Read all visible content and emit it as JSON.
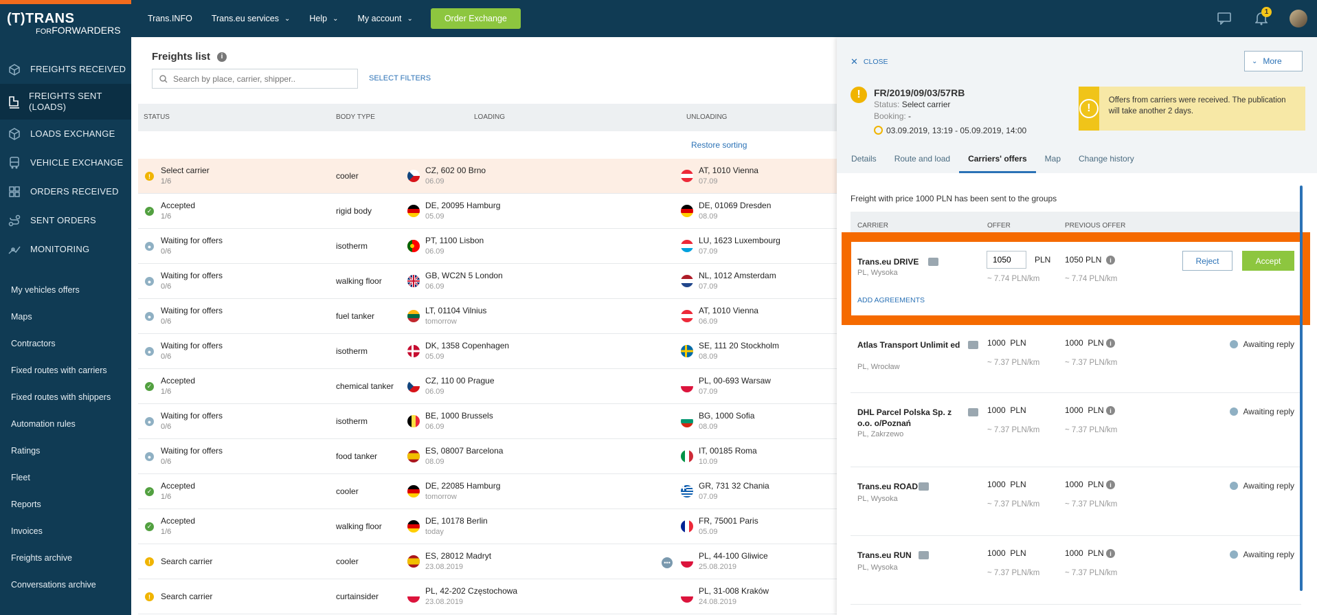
{
  "brand": {
    "line1": "(T)TRANS",
    "line2_prefix": "FOR",
    "line2": "FORWARDERS"
  },
  "sidebar": {
    "main": [
      {
        "label": "FREIGHTS RECEIVED",
        "icon": "freights-received-icon"
      },
      {
        "label": "FREIGHTS SENT (LOADS)",
        "icon": "freights-sent-icon",
        "active": true
      },
      {
        "label": "LOADS EXCHANGE",
        "icon": "box-icon"
      },
      {
        "label": "VEHICLE EXCHANGE",
        "icon": "truck-icon"
      },
      {
        "label": "ORDERS RECEIVED",
        "icon": "grid-icon"
      },
      {
        "label": "SENT ORDERS",
        "icon": "route-icon"
      },
      {
        "label": "MONITORING",
        "icon": "monitoring-icon"
      }
    ],
    "sub": [
      "My vehicles offers",
      "Maps",
      "Contractors",
      "Fixed routes with carriers",
      "Fixed routes with shippers",
      "Automation rules",
      "Ratings",
      "Fleet",
      "Reports",
      "Invoices",
      "Freights archive",
      "Conversations archive"
    ]
  },
  "topbar": {
    "items": [
      "Trans.INFO",
      "Trans.eu services",
      "Help",
      "My account"
    ],
    "order_button": "Order Exchange",
    "notification_count": "1"
  },
  "list": {
    "title": "Freights list",
    "search_placeholder": "Search by place, carrier, shipper..",
    "select_filters": "SELECT FILTERS",
    "headers": {
      "status": "STATUS",
      "body": "BODY TYPE",
      "loading": "LOADING",
      "unloading": "UNLOADING"
    },
    "restore_sorting": "Restore sorting",
    "rows": [
      {
        "status": "Select carrier",
        "sub": "1/6",
        "state": "warn",
        "body": "cooler",
        "load": "CZ, 602 00 Brno",
        "load_date": "06.09",
        "load_flag": "cz",
        "unload": "AT, 1010 Vienna",
        "unload_date": "07.09",
        "unload_flag": "at",
        "highlight": true
      },
      {
        "status": "Accepted",
        "sub": "1/6",
        "state": "ok",
        "body": "rigid body",
        "load": "DE, 20095 Hamburg",
        "load_date": "05.09",
        "load_flag": "de",
        "unload": "DE, 01069 Dresden",
        "unload_date": "08.09",
        "unload_flag": "de"
      },
      {
        "status": "Waiting for offers",
        "sub": "0/6",
        "state": "wait",
        "body": "isotherm",
        "load": "PT, 1100 Lisbon",
        "load_date": "06.09",
        "load_flag": "pt",
        "unload": "LU, 1623 Luxembourg",
        "unload_date": "07.09",
        "unload_flag": "lu"
      },
      {
        "status": "Waiting for offers",
        "sub": "0/6",
        "state": "wait",
        "body": "walking floor",
        "load": "GB, WC2N 5 London",
        "load_date": "06.09",
        "load_flag": "gb",
        "unload": "NL, 1012 Amsterdam",
        "unload_date": "07.09",
        "unload_flag": "nl"
      },
      {
        "status": "Waiting for offers",
        "sub": "0/6",
        "state": "wait",
        "body": "fuel tanker",
        "load": "LT, 01104 Vilnius",
        "load_date": "tomorrow",
        "load_flag": "lt",
        "unload": "AT, 1010 Vienna",
        "unload_date": "06.09",
        "unload_flag": "at"
      },
      {
        "status": "Waiting for offers",
        "sub": "0/6",
        "state": "wait",
        "body": "isotherm",
        "load": "DK, 1358 Copenhagen",
        "load_date": "05.09",
        "load_flag": "dk",
        "unload": "SE, 111 20 Stockholm",
        "unload_date": "08.09",
        "unload_flag": "se"
      },
      {
        "status": "Accepted",
        "sub": "1/6",
        "state": "ok",
        "body": "chemical tanker",
        "load": "CZ, 110 00 Prague",
        "load_date": "06.09",
        "load_flag": "cz",
        "unload": "PL, 00-693 Warsaw",
        "unload_date": "07.09",
        "unload_flag": "pl"
      },
      {
        "status": "Waiting for offers",
        "sub": "0/6",
        "state": "wait",
        "body": "isotherm",
        "load": "BE, 1000 Brussels",
        "load_date": "06.09",
        "load_flag": "be",
        "unload": "BG, 1000 Sofia",
        "unload_date": "08.09",
        "unload_flag": "bg"
      },
      {
        "status": "Waiting for offers",
        "sub": "0/6",
        "state": "wait",
        "body": "food tanker",
        "load": "ES, 08007 Barcelona",
        "load_date": "08.09",
        "load_flag": "es",
        "unload": "IT, 00185 Roma",
        "unload_date": "10.09",
        "unload_flag": "it"
      },
      {
        "status": "Accepted",
        "sub": "1/6",
        "state": "ok",
        "body": "cooler",
        "load": "DE, 22085 Hamburg",
        "load_date": "tomorrow",
        "load_flag": "de",
        "unload": "GR, 731 32 Chania",
        "unload_date": "07.09",
        "unload_flag": "gr"
      },
      {
        "status": "Accepted",
        "sub": "1/6",
        "state": "ok",
        "body": "walking floor",
        "load": "DE, 10178 Berlin",
        "load_date": "today",
        "load_flag": "de",
        "unload": "FR, 75001 Paris",
        "unload_date": "05.09",
        "unload_flag": "fr"
      },
      {
        "status": "Search carrier",
        "sub": "",
        "state": "warn",
        "body": "cooler",
        "load": "ES, 28012 Madryt",
        "load_date": "23.08.2019",
        "load_flag": "es",
        "unload": "PL, 44-100 Gliwice",
        "unload_date": "25.08.2019",
        "unload_flag": "pl",
        "dots": true
      },
      {
        "status": "Search carrier",
        "sub": "",
        "state": "warn",
        "body": "curtainsider",
        "load": "PL, 42-202 Częstochowa",
        "load_date": "23.08.2019",
        "load_flag": "pl",
        "unload": "PL, 31-008 Kraków",
        "unload_date": "24.08.2019",
        "unload_flag": "pl"
      }
    ]
  },
  "panel": {
    "close": "CLOSE",
    "more": "More",
    "freight_id": "FR/2019/09/03/57RB",
    "status_label": "Status:",
    "status_value": "Select carrier",
    "booking_label": "Booking:",
    "booking_value": "-",
    "time_range": "03.09.2019, 13:19 - 05.09.2019, 14:00",
    "alert": "Offers from carriers were received. The publication will take another 2 days.",
    "tabs": [
      "Details",
      "Route and load",
      "Carriers' offers",
      "Map",
      "Change history"
    ],
    "active_tab": 2,
    "sent_note": "Freight with price 1000 PLN has been sent to the groups",
    "headers": {
      "carrier": "CARRIER",
      "offer": "OFFER",
      "previous": "PREVIOUS OFFER"
    },
    "currency": "PLN",
    "first": {
      "name": "Trans.eu DRIVE",
      "loc": "PL, Wysoka",
      "offer": "1050",
      "prev": "1050",
      "perkm": "~ 7.74 PLN/km",
      "prev_perkm": "~ 7.74 PLN/km",
      "reject": "Reject",
      "accept": "Accept",
      "add_agreements": "ADD AGREEMENTS"
    },
    "offers": [
      {
        "name": "Atlas Transport Unlimit ed",
        "loc": "PL, Wrocław",
        "offer": "1000",
        "prev": "1000",
        "perkm": "~ 7.37 PLN/km",
        "status": "Awaiting reply"
      },
      {
        "name": "DHL Parcel Polska Sp. z o.o. o/Poznań",
        "loc": "PL, Zakrzewo",
        "offer": "1000",
        "prev": "1000",
        "perkm": "~ 7.37 PLN/km",
        "status": "Awaiting reply"
      },
      {
        "name": "Trans.eu ROAD",
        "loc": "PL, Wysoka",
        "offer": "1000",
        "prev": "1000",
        "perkm": "~ 7.37 PLN/km",
        "status": "Awaiting reply"
      },
      {
        "name": "Trans.eu RUN",
        "loc": "PL, Wysoka",
        "offer": "1000",
        "prev": "1000",
        "perkm": "~ 7.37 PLN/km",
        "status": "Awaiting reply"
      }
    ]
  },
  "colors": {
    "navy": "#103b54",
    "orange": "#f26b1d",
    "green": "#8dc63f",
    "highlight_border": "#f56a00",
    "link": "#2b72b6"
  }
}
